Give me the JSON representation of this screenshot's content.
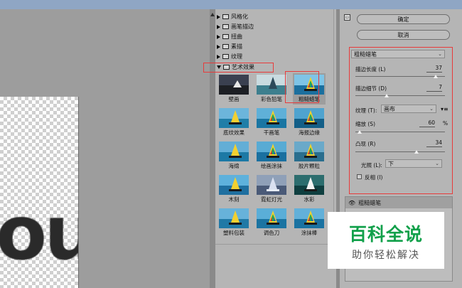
{
  "gallery": {
    "folders": [
      {
        "label": "风格化",
        "open": false
      },
      {
        "label": "画笔描边",
        "open": false
      },
      {
        "label": "扭曲",
        "open": false
      },
      {
        "label": "素描",
        "open": false
      },
      {
        "label": "纹理",
        "open": false
      },
      {
        "label": "艺术效果",
        "open": true
      }
    ],
    "thumbnails": [
      {
        "label": "壁画"
      },
      {
        "label": "彩色铅笔"
      },
      {
        "label": "粗糙蜡笔"
      },
      {
        "label": "底纹效果"
      },
      {
        "label": "干画笔"
      },
      {
        "label": "海报边缘"
      },
      {
        "label": "海绵"
      },
      {
        "label": "绘画涂抹"
      },
      {
        "label": "胶片颗粒"
      },
      {
        "label": "木刻"
      },
      {
        "label": "霓虹灯光"
      },
      {
        "label": "水彩"
      },
      {
        "label": "塑料包装"
      },
      {
        "label": "调色刀"
      },
      {
        "label": "涂抹棒"
      }
    ],
    "selected": "粗糙蜡笔"
  },
  "buttons": {
    "ok": "确定",
    "cancel": "取消"
  },
  "filter": {
    "selected": "粗糙蜡笔",
    "stroke_length_label": "描边长度 (L)",
    "stroke_length_value": "37",
    "stroke_length_fraction": 0.9,
    "stroke_detail_label": "描边细节 (D)",
    "stroke_detail_value": "7",
    "stroke_detail_fraction": 0.35,
    "texture_label": "纹理 (T):",
    "texture_value": "画布",
    "scaling_label": "缩放 (S)",
    "scaling_value": "60",
    "scaling_unit": "%",
    "scaling_fraction": 0.05,
    "relief_label": "凸现 (R)",
    "relief_value": "34",
    "relief_fraction": 0.68,
    "light_label": "光照 (L):",
    "light_value": "下",
    "invert_label": "反相 (I)"
  },
  "layers": {
    "current": "粗糙蜡笔"
  },
  "preview": {
    "text": "ou"
  },
  "watermark": {
    "title": "百科全说",
    "subtitle": "助你轻松解决"
  },
  "colors": {
    "accent_red": "#e83b3b",
    "watermark_green": "#11a04a"
  }
}
